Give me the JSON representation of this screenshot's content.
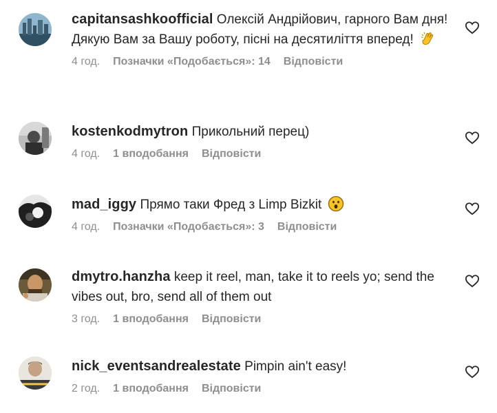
{
  "comments": [
    {
      "username": "capitansashkoofficial",
      "text": "Олексій Андрійович, гарного Вам дня! Дякую Вам за Вашу роботу, пісні на десятиліття вперед!",
      "emoji": "clapping-hands-emoji",
      "time": "4 год.",
      "likes": "Позначки «Подобається»: 14",
      "reply": "Відповісти",
      "avatar": "city-skyline-avatar",
      "avatar_color": "#3d6f8e"
    },
    {
      "username": "kostenkodmytron",
      "text": "Прикольний перец)",
      "emoji": "",
      "time": "4 год.",
      "likes": "1 вподобання",
      "reply": "Відповісти",
      "avatar": "grayscale-photo-avatar",
      "avatar_color": "#555555"
    },
    {
      "username": "mad_iggy",
      "text": "Прямо таки Фред з Limp Bizkit",
      "emoji": "astonished-face-emoji",
      "time": "4 год.",
      "likes": "Позначки «Подобається»: 3",
      "reply": "Відповісти",
      "avatar": "black-white-avatar",
      "avatar_color": "#2b2b2b"
    },
    {
      "username": "dmytro.hanzha",
      "text": "keep it reel, man, take it to reels yo; send the vibes out, bro, send all of them out",
      "emoji": "",
      "time": "3 год.",
      "likes": "1 вподобання",
      "reply": "Відповісти",
      "avatar": "face-avatar",
      "avatar_color": "#8a6a3c"
    },
    {
      "username": "nick_eventsandrealestate",
      "text": "Pimpin ain't easy!",
      "emoji": "",
      "time": "2 год.",
      "likes": "1 вподобання",
      "reply": "Відповісти",
      "avatar": "man-portrait-avatar",
      "avatar_color": "#9c8670"
    }
  ],
  "colors": {
    "text": "#262626",
    "muted": "#8e8e8e",
    "background": "#ffffff"
  }
}
